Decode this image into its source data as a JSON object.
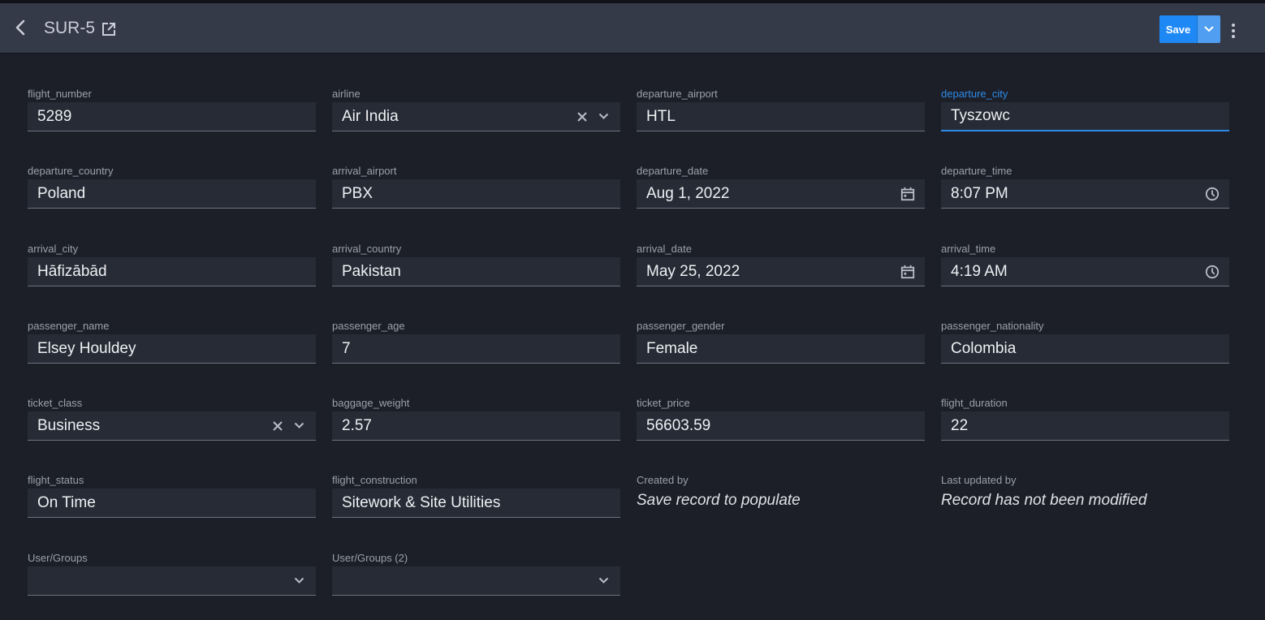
{
  "header": {
    "title": "SUR-5",
    "save_label": "Save"
  },
  "fields": {
    "flight_number": {
      "label": "flight_number",
      "value": "5289"
    },
    "airline": {
      "label": "airline",
      "value": "Air India"
    },
    "departure_airport": {
      "label": "departure_airport",
      "value": "HTL"
    },
    "departure_city": {
      "label": "departure_city",
      "value": "Tyszowc"
    },
    "departure_country": {
      "label": "departure_country",
      "value": "Poland"
    },
    "arrival_airport": {
      "label": "arrival_airport",
      "value": "PBX"
    },
    "departure_date": {
      "label": "departure_date",
      "value": "Aug 1, 2022"
    },
    "departure_time": {
      "label": "departure_time",
      "value": "8:07 PM"
    },
    "arrival_city": {
      "label": "arrival_city",
      "value": "Hāfizābād"
    },
    "arrival_country": {
      "label": "arrival_country",
      "value": "Pakistan"
    },
    "arrival_date": {
      "label": "arrival_date",
      "value": "May 25, 2022"
    },
    "arrival_time": {
      "label": "arrival_time",
      "value": "4:19 AM"
    },
    "passenger_name": {
      "label": "passenger_name",
      "value": "Elsey Houldey"
    },
    "passenger_age": {
      "label": "passenger_age",
      "value": "7"
    },
    "passenger_gender": {
      "label": "passenger_gender",
      "value": "Female"
    },
    "passenger_nationality": {
      "label": "passenger_nationality",
      "value": "Colombia"
    },
    "ticket_class": {
      "label": "ticket_class",
      "value": "Business"
    },
    "baggage_weight": {
      "label": "baggage_weight",
      "value": "2.57"
    },
    "ticket_price": {
      "label": "ticket_price",
      "value": "56603.59"
    },
    "flight_duration": {
      "label": "flight_duration",
      "value": "22"
    },
    "flight_status": {
      "label": "flight_status",
      "value": "On Time"
    },
    "flight_construction": {
      "label": "flight_construction",
      "value": "Sitework & Site Utilities"
    },
    "created_by": {
      "label": "Created by",
      "value": "Save record to populate"
    },
    "last_updated_by": {
      "label": "Last updated by",
      "value": "Record has not been modified"
    },
    "user_groups": {
      "label": "User/Groups",
      "value": ""
    },
    "user_groups_2": {
      "label": "User/Groups (2)",
      "value": ""
    }
  },
  "colors": {
    "background": "#1c1f28",
    "header": "#343a48",
    "input": "#272b36",
    "accent": "#1e88f5",
    "focus": "#2e8ae6"
  },
  "icons": [
    "back-chevron-icon",
    "open-external-icon",
    "chevron-down-icon",
    "kebab-menu-icon",
    "clear-x-icon",
    "calendar-icon",
    "clock-icon"
  ]
}
